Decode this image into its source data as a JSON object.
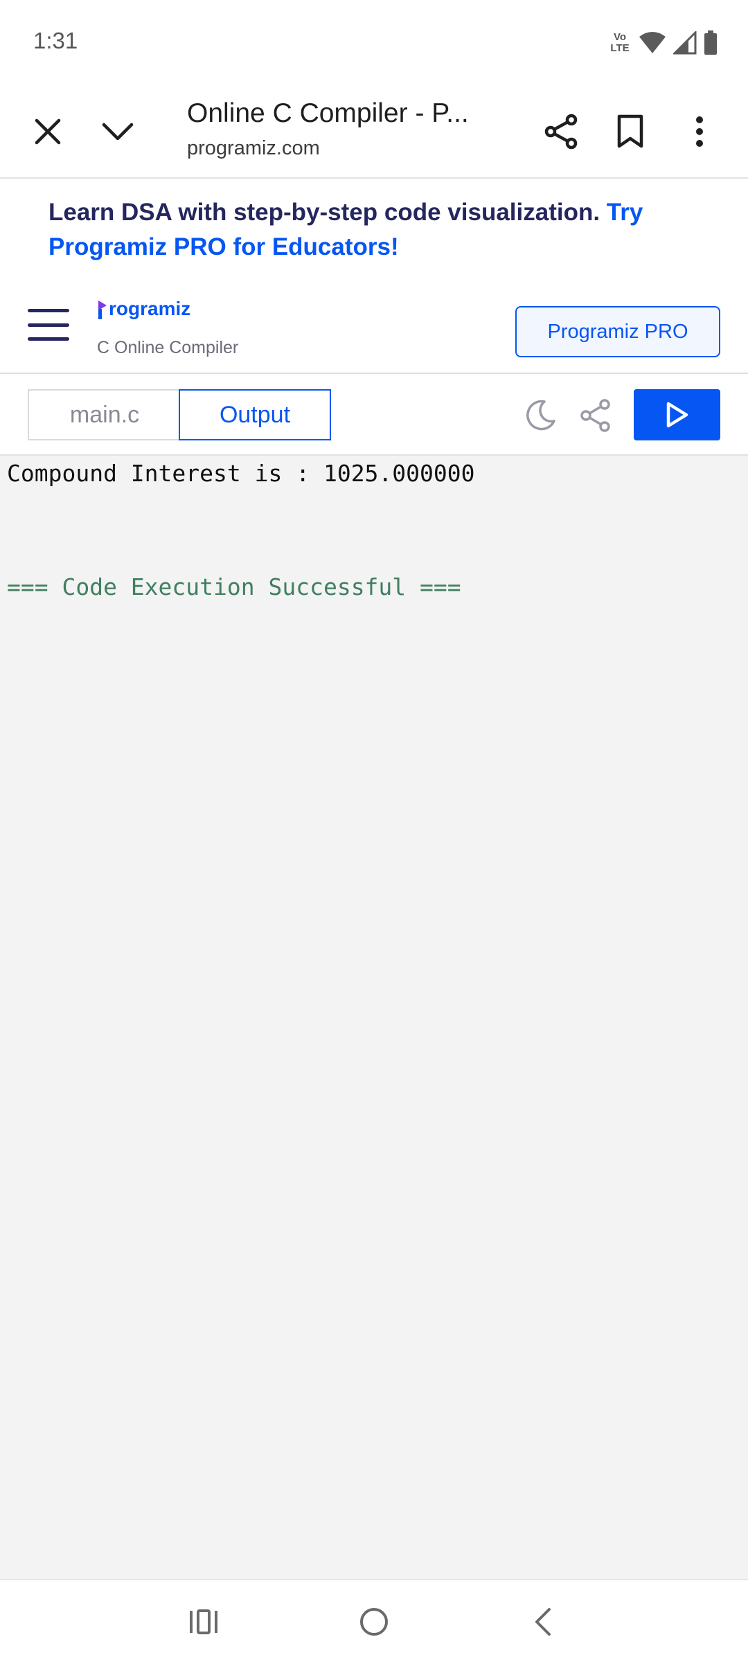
{
  "status_bar": {
    "time": "1:31",
    "volte_label": "Vo\nLTE",
    "icons": [
      "volte-icon",
      "wifi-icon",
      "cell-signal-icon",
      "battery-icon"
    ]
  },
  "browser": {
    "page_title": "Online C Compiler - P...",
    "url": "programiz.com",
    "icons": [
      "close-icon",
      "chevron-down-icon",
      "share-icon",
      "bookmark-icon",
      "more-vert-icon"
    ]
  },
  "banner": {
    "text": "Learn DSA with step-by-step code visualization. ",
    "link_text": "Try Programiz PRO for Educators!"
  },
  "site_header": {
    "logo_text": "rogramiz",
    "subtitle": "C Online Compiler",
    "pro_button": "Programiz PRO"
  },
  "editor": {
    "tabs": [
      {
        "label": "main.c",
        "active": false
      },
      {
        "label": "Output",
        "active": true
      }
    ],
    "icons": [
      "moon-icon",
      "share-icon",
      "play-icon"
    ]
  },
  "output": {
    "result_line": "Compound Interest is : 1025.000000",
    "status_line": "=== Code Execution Successful ==="
  },
  "colors": {
    "primary": "#0556f3",
    "banner_text": "#25265e",
    "success_text": "#3f7f5f",
    "output_bg": "#f3f3f4"
  }
}
